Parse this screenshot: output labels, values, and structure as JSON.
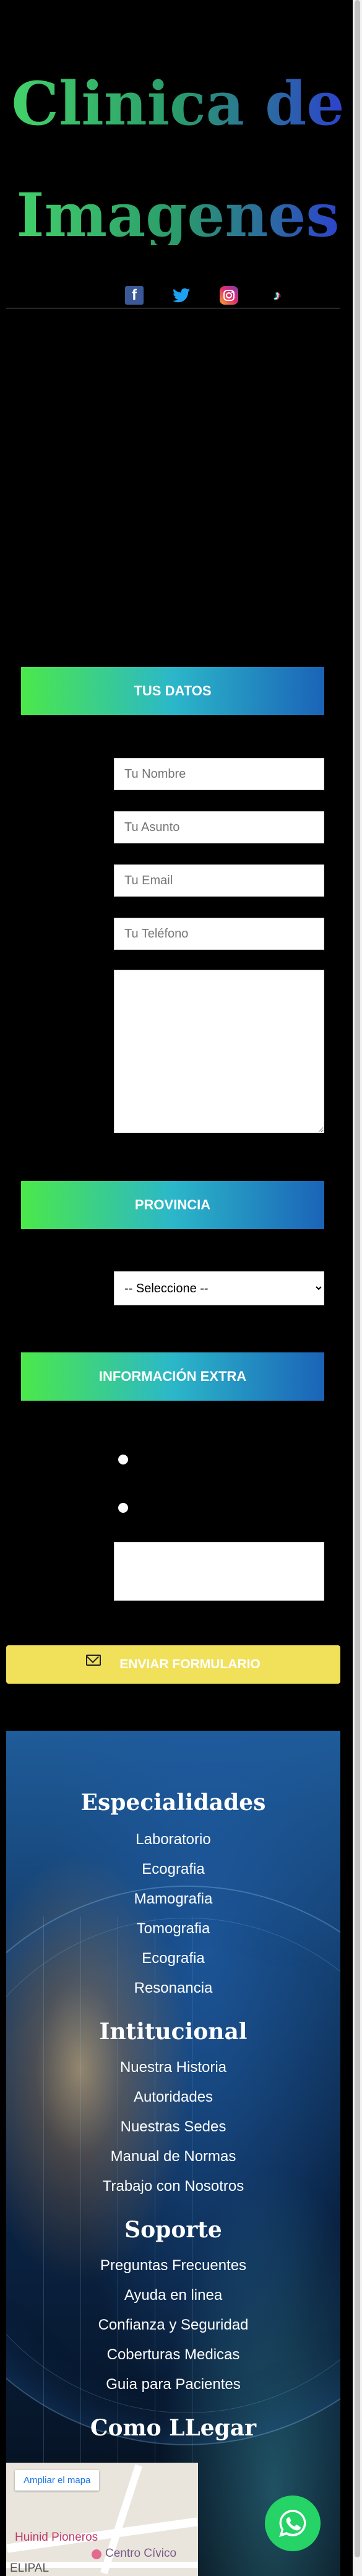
{
  "header": {
    "title_line1": "Clinica de",
    "title_line2": "Imagenes",
    "social": [
      "facebook-icon",
      "twitter-icon",
      "instagram-icon",
      "tiktok-icon"
    ]
  },
  "form": {
    "section_datos": "TUS DATOS",
    "name_placeholder": "Tu Nombre",
    "subject_placeholder": "Tu Asunto",
    "email_placeholder": "Tu Email",
    "phone_placeholder": "Tu Teléfono",
    "section_provincia": "PROVINCIA",
    "provincia_selected": "-- Seleccione --",
    "section_extra": "INFORMACIÓN EXTRA",
    "submit_label": "ENVIAR FORMULARIO"
  },
  "footer": {
    "especialidades": {
      "heading": "Especialidades",
      "items": [
        "Laboratorio",
        "Ecografia",
        "Mamografia",
        "Tomografia",
        "Ecografia",
        "Resonancia"
      ]
    },
    "institucional": {
      "heading": "Intitucional",
      "items": [
        "Nuestra Historia",
        "Autoridades",
        "Nuestras Sedes",
        "Manual de Normas",
        "Trabajo con Nosotros"
      ]
    },
    "soporte": {
      "heading": "Soporte",
      "items": [
        "Preguntas Frecuentes",
        "Ayuda en linea",
        "Confianza y Seguridad",
        "Coberturas Medicas",
        "Guia para Pacientes"
      ]
    },
    "llegar": {
      "heading": "Como LLegar"
    }
  },
  "map": {
    "button_label": "Ampliar el mapa",
    "place1": "Huinid Pioneros",
    "place2": "Centro Cívico",
    "place3": "ELIPAL"
  },
  "colors": {
    "accent_green": "#4be84a",
    "accent_blue": "#1b63b8",
    "submit_yellow": "#f1e05a",
    "whatsapp": "#25d366"
  }
}
